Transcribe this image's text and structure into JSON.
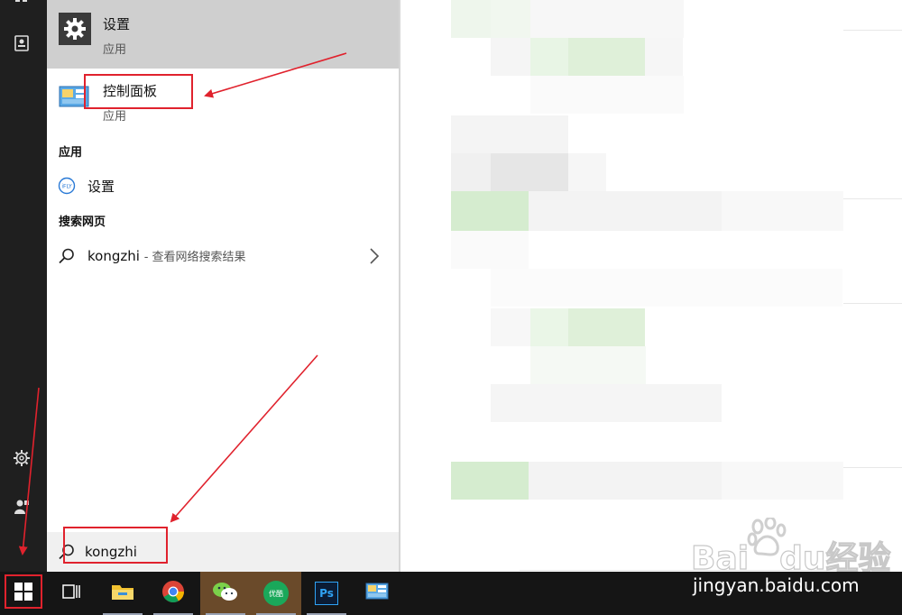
{
  "best_match": {
    "title": "设置",
    "subtitle": "应用",
    "icon": "gear-icon"
  },
  "second_result": {
    "title": "控制面板",
    "subtitle": "应用",
    "icon": "control-panel-icon"
  },
  "apps_section": {
    "heading": "应用",
    "items": [
      {
        "label": "设置",
        "icon": "iflytek-icon"
      }
    ]
  },
  "web_section": {
    "heading": "搜索网页",
    "query": "kongzhi",
    "hint": "- 查看网络搜索结果",
    "icon": "search-icon"
  },
  "search_box": {
    "value": "kongzhi",
    "icon": "search-icon"
  },
  "rail": {
    "items": [
      "tiles-icon",
      "contact-icon",
      "settings-icon",
      "user-icon"
    ]
  },
  "taskbar": {
    "items": [
      {
        "name": "start-button",
        "icon": "windows-icon"
      },
      {
        "name": "task-view-button",
        "icon": "task-view-icon"
      },
      {
        "name": "file-explorer-button",
        "icon": "folder-icon"
      },
      {
        "name": "chrome-button",
        "icon": "chrome-icon"
      },
      {
        "name": "wechat-button",
        "icon": "wechat-icon"
      },
      {
        "name": "youku-button",
        "icon": "youku-icon",
        "label": "优酷"
      },
      {
        "name": "photoshop-button",
        "icon": "photoshop-icon",
        "label": "Ps"
      },
      {
        "name": "control-panel-task-button",
        "icon": "control-panel-icon"
      }
    ]
  },
  "watermark": {
    "brand_latin_1": "Bai",
    "brand_latin_2": "du",
    "brand_cn": "经验",
    "url": "jingyan.baidu.com"
  },
  "colors": {
    "annotation_red": "#e0222d",
    "best_match_bg": "#cfcfcf",
    "rail_bg": "#1f1f1f",
    "taskbar_bg": "#151515"
  }
}
